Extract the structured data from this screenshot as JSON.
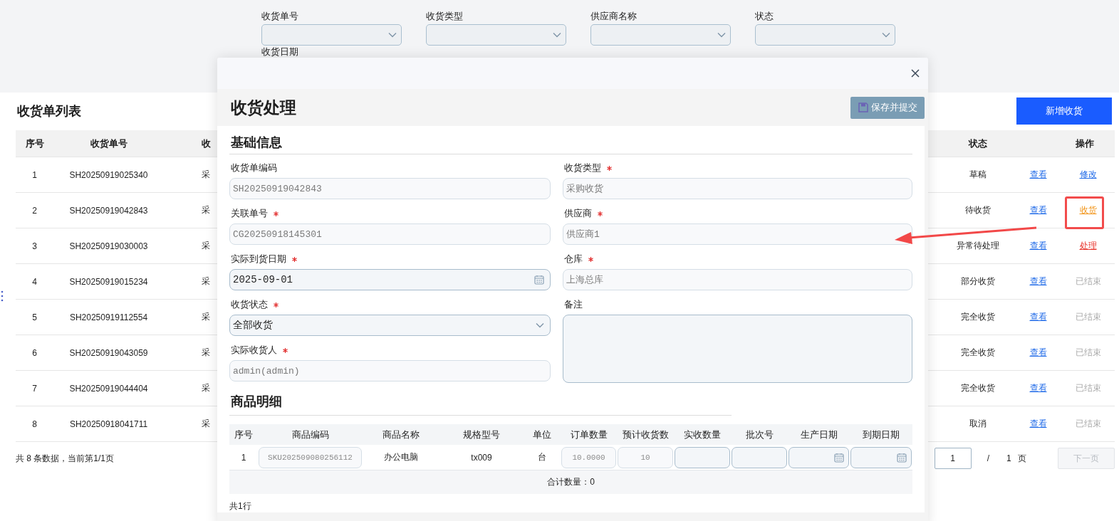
{
  "filters": [
    {
      "label": "收货单号"
    },
    {
      "label": "收货类型"
    },
    {
      "label": "供应商名称"
    },
    {
      "label": "状态"
    }
  ],
  "filter_row2_label": "收货日期",
  "list": {
    "title": "收货单列表",
    "new_button": "新增收货",
    "columns": [
      {
        "label": "序号",
        "kind": "seq"
      },
      {
        "label": "收货单号",
        "kind": "code"
      },
      {
        "label": "收",
        "kind": "type"
      },
      {
        "label": "状态",
        "kind": "status"
      },
      {
        "label": "操作",
        "kind": "ops"
      }
    ],
    "rows": [
      {
        "seq": "1",
        "code": "SH20250919025340",
        "type": "采",
        "status": "草稿",
        "view": "查看",
        "action": {
          "label": "修改",
          "kind": "edit"
        }
      },
      {
        "seq": "2",
        "code": "SH20250919042843",
        "type": "采",
        "status": "待收货",
        "view": "查看",
        "action": {
          "label": "收货",
          "kind": "receive"
        }
      },
      {
        "seq": "3",
        "code": "SH20250919030003",
        "type": "采",
        "status": "异常待处理",
        "view": "查看",
        "action": {
          "label": "处理",
          "kind": "handle"
        }
      },
      {
        "seq": "4",
        "code": "SH20250919015234",
        "type": "采",
        "status": "部分收货",
        "view": "查看",
        "action": {
          "label": "已结束",
          "kind": "closed"
        }
      },
      {
        "seq": "5",
        "code": "SH20250919112554",
        "type": "采",
        "status": "完全收货",
        "view": "查看",
        "action": {
          "label": "已结束",
          "kind": "closed"
        }
      },
      {
        "seq": "6",
        "code": "SH20250919043059",
        "type": "采",
        "status": "完全收货",
        "view": "查看",
        "action": {
          "label": "已结束",
          "kind": "closed"
        }
      },
      {
        "seq": "7",
        "code": "SH20250919044404",
        "type": "采",
        "status": "完全收货",
        "view": "查看",
        "action": {
          "label": "已结束",
          "kind": "closed"
        }
      },
      {
        "seq": "8",
        "code": "SH20250918041711",
        "type": "采",
        "status": "取消",
        "view": "查看",
        "action": {
          "label": "已结束",
          "kind": "closed"
        }
      }
    ],
    "footer": {
      "summary": "共 8 条数据，当前第1/1页",
      "page": "1",
      "separator": "/",
      "total": "1 页",
      "next": {
        "label": "下一页",
        "disabled": true
      }
    }
  },
  "modal": {
    "title": "收货处理",
    "save_button": "保存并提交",
    "basic_title": "基础信息",
    "left": [
      {
        "label": "收货单编码",
        "required": false,
        "kind": "text",
        "readonly": true,
        "value": "SH20250919042843"
      },
      {
        "label": "关联单号",
        "required": true,
        "kind": "text",
        "readonly": true,
        "value": "CG20250918145301"
      },
      {
        "label": "实际到货日期",
        "required": true,
        "kind": "date",
        "readonly": false,
        "value": "2025-09-01"
      },
      {
        "label": "收货状态",
        "required": true,
        "kind": "select",
        "readonly": false,
        "value": "全部收货"
      },
      {
        "label": "实际收货人",
        "required": true,
        "kind": "text",
        "readonly": true,
        "value": "admin(admin)"
      }
    ],
    "right": [
      {
        "label": "收货类型",
        "required": true,
        "kind": "text",
        "readonly": true,
        "value": "采购收货"
      },
      {
        "label": "供应商",
        "required": true,
        "kind": "text",
        "readonly": true,
        "value": "供应商1"
      },
      {
        "label": "仓库",
        "required": true,
        "kind": "text",
        "readonly": true,
        "value": "上海总库"
      },
      {
        "label": "备注",
        "required": false,
        "kind": "textarea",
        "readonly": false
      }
    ],
    "detail_title": "商品明细",
    "detail": {
      "columns": [
        "序号",
        "商品编码",
        "商品名称",
        "规格型号",
        "单位",
        "订单数量",
        "预计收货数",
        "实收数量",
        "批次号",
        "生产日期",
        "到期日期"
      ],
      "rows": [
        {
          "cells": [
            {
              "kind": "text",
              "value": "1"
            },
            {
              "kind": "readonly",
              "value": "SKU202509080256112"
            },
            {
              "kind": "text",
              "value": "办公电脑"
            },
            {
              "kind": "text",
              "value": "tx009"
            },
            {
              "kind": "text",
              "value": "台"
            },
            {
              "kind": "readonly",
              "value": "10.0000"
            },
            {
              "kind": "readonly",
              "value": "10"
            },
            {
              "kind": "input"
            },
            {
              "kind": "input"
            },
            {
              "kind": "date"
            },
            {
              "kind": "date"
            }
          ]
        }
      ],
      "total": "合计数量：0",
      "count": "共1行"
    }
  }
}
